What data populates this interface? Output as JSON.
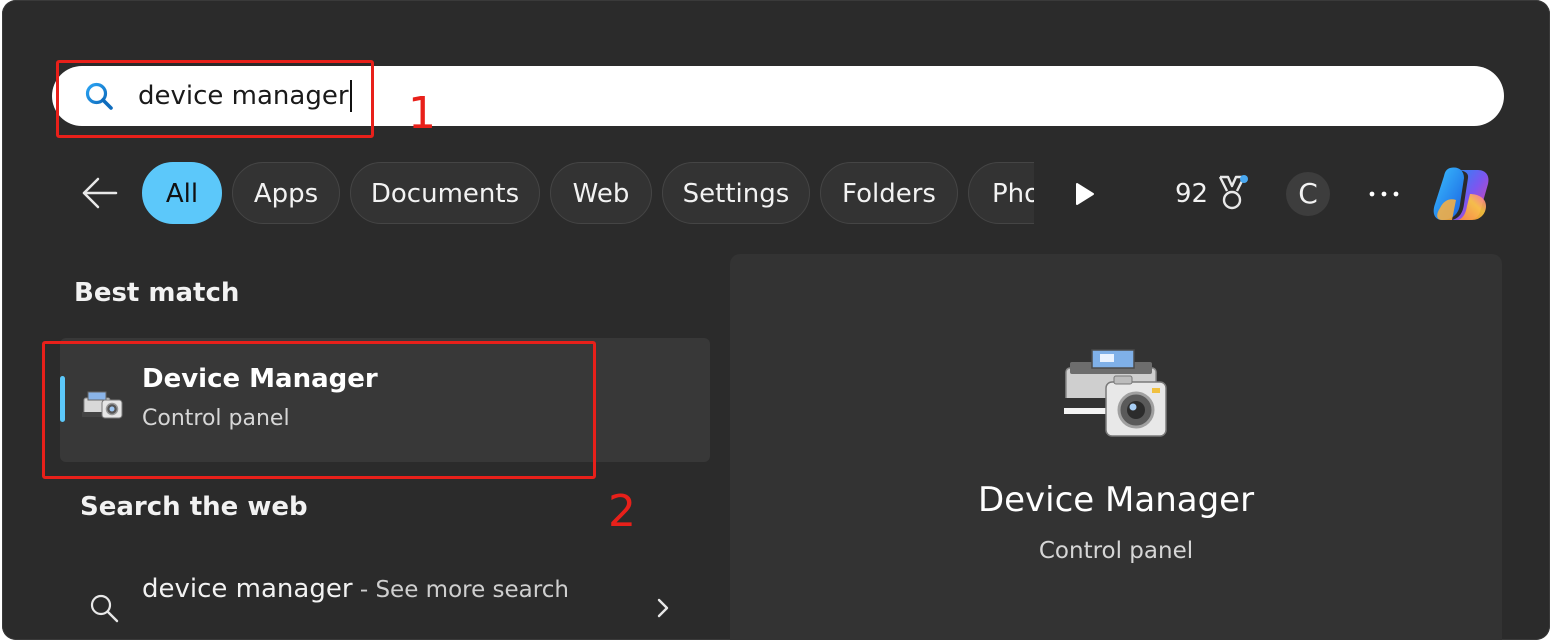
{
  "search": {
    "query": "device manager"
  },
  "annotations": {
    "step1": "1",
    "step2": "2",
    "color": "#e8201a"
  },
  "filters": {
    "chips": [
      "All",
      "Apps",
      "Documents",
      "Web",
      "Settings",
      "Folders",
      "Pho"
    ],
    "active_chip": "All",
    "points": "92",
    "avatar_initial": "C"
  },
  "best_match": {
    "title": "Best match",
    "item": {
      "title": "Device Manager",
      "subtitle": "Control panel",
      "icon": "device-manager-icon"
    }
  },
  "web": {
    "title": "Search the web",
    "query": "device manager",
    "suffix": " - See more search"
  },
  "detail": {
    "title": "Device Manager",
    "subtitle": "Control panel",
    "icon": "device-manager-icon"
  },
  "colors": {
    "accent": "#5cc8fa",
    "panel_bg": "#2b2b2b"
  }
}
